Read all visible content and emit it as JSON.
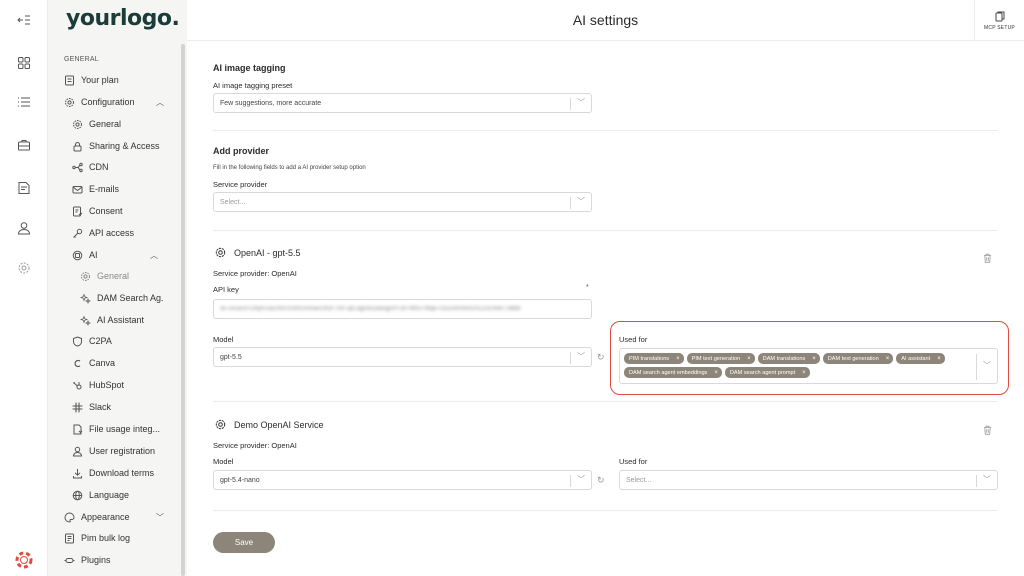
{
  "app": {
    "logo": "yourlogo.",
    "page_title": "AI settings",
    "mcp_label": "MCP SETUP"
  },
  "rail": {
    "icons": [
      "collapse-icon",
      "grid-icon",
      "list-icon",
      "briefcase-icon",
      "document-icon",
      "user-icon",
      "settings-icon",
      "lifebuoy-icon"
    ]
  },
  "sidebar": {
    "section": "GENERAL",
    "items": [
      {
        "label": "Your plan",
        "icon": "plan-icon"
      },
      {
        "label": "Configuration",
        "icon": "gear-icon",
        "expanded": true
      },
      {
        "label": "General",
        "icon": "gear-icon"
      },
      {
        "label": "Sharing & Access",
        "icon": "lock-icon"
      },
      {
        "label": "CDN",
        "icon": "network-icon"
      },
      {
        "label": "E-mails",
        "icon": "mail-icon"
      },
      {
        "label": "Consent",
        "icon": "consent-icon"
      },
      {
        "label": "API access",
        "icon": "key-icon"
      },
      {
        "label": "AI",
        "icon": "ai-icon",
        "expanded": true
      },
      {
        "label": "General",
        "icon": "gear-icon",
        "active": true
      },
      {
        "label": "DAM Search Ag.",
        "icon": "sparkle-icon"
      },
      {
        "label": "AI Assistant",
        "icon": "sparkle-icon"
      },
      {
        "label": "C2PA",
        "icon": "shield-icon"
      },
      {
        "label": "Canva",
        "icon": "canva-icon"
      },
      {
        "label": "HubSpot",
        "icon": "hubspot-icon"
      },
      {
        "label": "Slack",
        "icon": "slack-icon"
      },
      {
        "label": "File usage integ...",
        "icon": "file-icon"
      },
      {
        "label": "User registration",
        "icon": "user-icon"
      },
      {
        "label": "Download terms",
        "icon": "download-icon"
      },
      {
        "label": "Language",
        "icon": "globe-icon"
      },
      {
        "label": "Appearance",
        "icon": "palette-icon",
        "expanded": false
      },
      {
        "label": "Pim bulk log",
        "icon": "log-icon"
      },
      {
        "label": "Plugins",
        "icon": "plugin-icon"
      }
    ]
  },
  "tagging": {
    "heading": "AI image tagging",
    "preset_label": "AI image tagging preset",
    "preset_value": "Few suggestions, more accurate"
  },
  "add_provider": {
    "heading": "Add provider",
    "help": "Fill in the following fields to add a AI provider setup option",
    "service_label": "Service provider",
    "service_placeholder": "Select..."
  },
  "openai": {
    "heading": "OpenAI - gpt-5.5",
    "service_provider": "Service provider: OpenAI",
    "api_key_label": "API key",
    "api_key_required": "*",
    "api_key_value": "sk-svcacct-O4yRJuERhcVcIKtUnmwcUfDF7bX-qlCagt3oGdavgc9YJ87WKx7Mqe7OGD4vN4AOVZDO44eT38Bb",
    "model_label": "Model",
    "model_value": "gpt-5.5",
    "used_for_label": "Used for",
    "used_for": [
      "PIM translations",
      "PIM text generation",
      "DAM translations",
      "DAM text generation",
      "AI assistant",
      "DAM search agent embeddings",
      "DAM search agent prompt"
    ]
  },
  "demo": {
    "heading": "Demo OpenAI Service",
    "service_provider": "Service provider: OpenAI",
    "model_label": "Model",
    "model_value": "gpt-5.4-nano",
    "used_for_label": "Used for",
    "used_for_placeholder": "Select..."
  },
  "actions": {
    "save_label": "Save"
  },
  "colors": {
    "accent": "#8e857a",
    "brand": "#1a3d39",
    "highlight": "#e04b3f"
  }
}
